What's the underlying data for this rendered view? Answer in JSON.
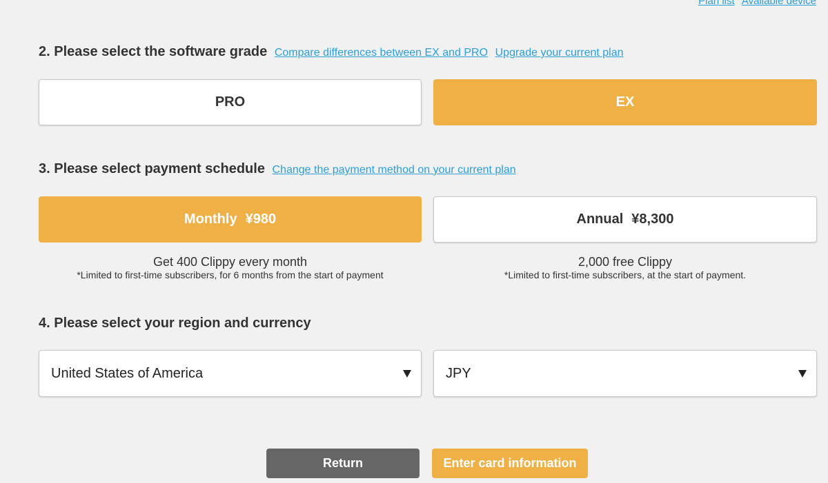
{
  "top_links": {
    "plan_list": "Plan list",
    "available_device": "Available device"
  },
  "grade": {
    "title": "2. Please select the software grade",
    "compare_link": "Compare differences between EX and PRO",
    "upgrade_link": "Upgrade your current plan",
    "options": {
      "pro": "PRO",
      "ex": "EX"
    },
    "selected": "EX"
  },
  "payment": {
    "title": "3. Please select payment schedule",
    "change_link": "Change the payment method on your current plan",
    "monthly": {
      "label": "Monthly",
      "price": "¥980",
      "description": "Get 400 Clippy every month",
      "note": "*Limited to first-time subscribers, for 6 months from the start of payment"
    },
    "annual": {
      "label": "Annual",
      "price": "¥8,300",
      "description": "2,000 free Clippy",
      "note": "*Limited to first-time subscribers, at the start of payment."
    },
    "selected": "Monthly"
  },
  "region": {
    "title": "4. Please select your region and currency",
    "region_value": "United States of America",
    "currency_value": "JPY"
  },
  "actions": {
    "return_label": "Return",
    "enter_card_label": "Enter card information"
  },
  "colors": {
    "accent": "#efb045",
    "link": "#2a9fd8",
    "background": "#f1f1f1",
    "return_button": "#666666"
  }
}
